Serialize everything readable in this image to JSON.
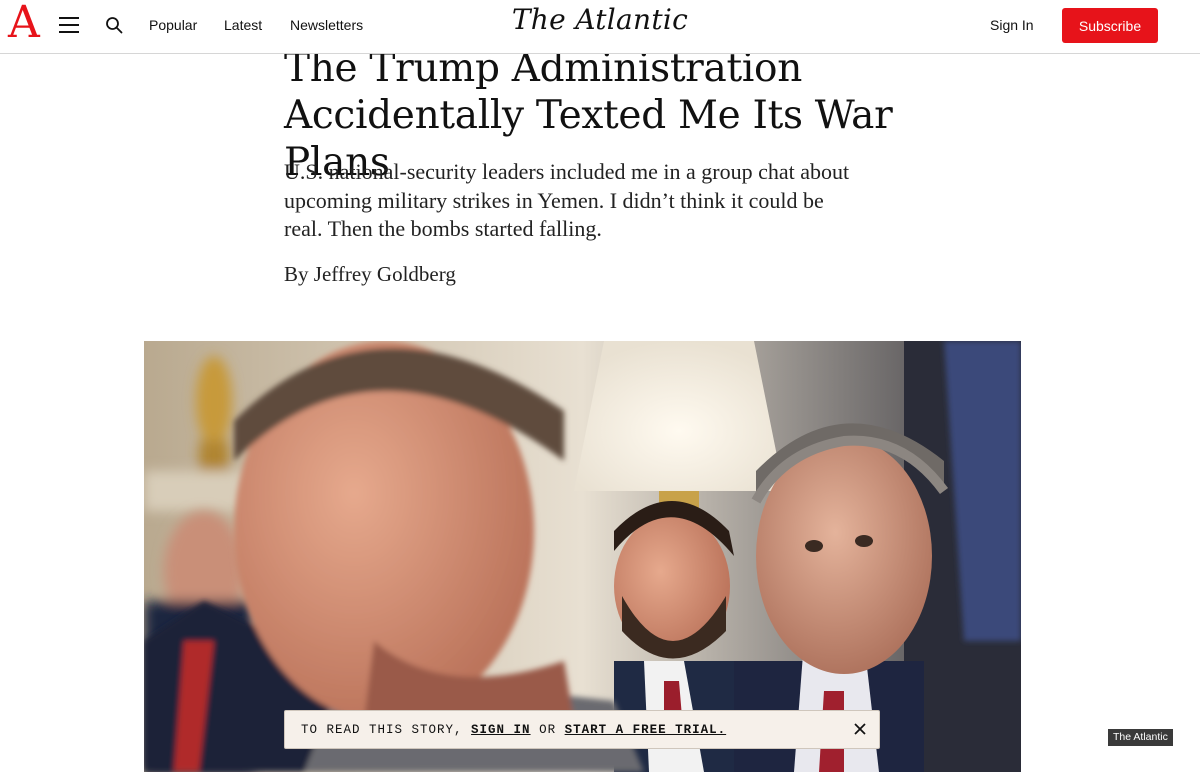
{
  "header": {
    "logo_letter": "A",
    "nav": [
      "Popular",
      "Latest",
      "Newsletters"
    ],
    "masthead": "The Atlantic",
    "sign_in": "Sign In",
    "subscribe": "Subscribe",
    "icons": {
      "menu": "hamburger-menu-icon",
      "search": "search-icon"
    },
    "colors": {
      "brand_red": "#e7131a"
    }
  },
  "article": {
    "title": "The Trump Administration Accidentally Texted Me Its War Plans",
    "dek": "U.S. national-security leaders included me in a group chat about upcoming military strikes in Yemen. I didn’t think it could be real. Then the bombs started falling.",
    "byline_prefix": "By",
    "author": "Jeffrey Goldberg"
  },
  "image": {
    "credit": "The Atlantic"
  },
  "paywall": {
    "prefix": "TO READ THIS STORY,",
    "sign_in": "SIGN IN",
    "middle": "OR",
    "trial": "START A FREE TRIAL.",
    "close_icon": "close-icon"
  }
}
